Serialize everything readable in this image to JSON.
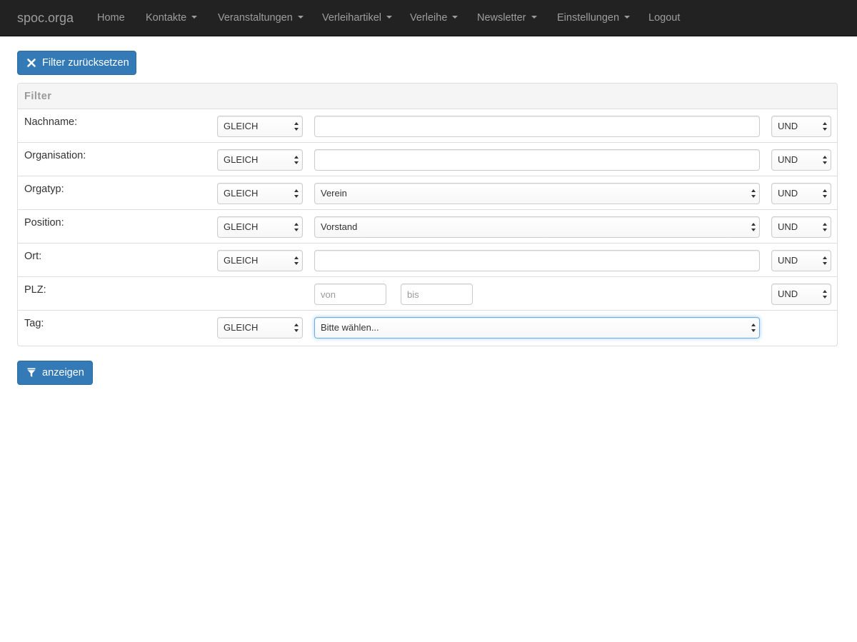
{
  "navbar": {
    "brand": "spoc.orga",
    "items": [
      {
        "label": "Home",
        "dropdown": false
      },
      {
        "label": "Kontakte",
        "dropdown": true
      },
      {
        "label": "Veranstaltungen",
        "dropdown": true
      },
      {
        "label": "Verleihartikel",
        "dropdown": true
      },
      {
        "label": "Verleihe",
        "dropdown": true
      },
      {
        "label": "Newsletter",
        "dropdown": true
      },
      {
        "label": "Einstellungen",
        "dropdown": true
      },
      {
        "label": "Logout",
        "dropdown": false
      }
    ]
  },
  "reset_button": {
    "label": "Filter zurücksetzen",
    "icon": "close-icon"
  },
  "filter": {
    "title": "Filter",
    "rows": [
      {
        "label": "Nachname:",
        "operator": "GLEICH",
        "value": "",
        "value_type": "text",
        "conjunction": "UND"
      },
      {
        "label": "Organisation:",
        "operator": "GLEICH",
        "value": "",
        "value_type": "text",
        "conjunction": "UND"
      },
      {
        "label": "Orgatyp:",
        "operator": "GLEICH",
        "value": "Verein",
        "value_type": "select",
        "conjunction": "UND"
      },
      {
        "label": "Position:",
        "operator": "GLEICH",
        "value": "Vorstand",
        "value_type": "select",
        "conjunction": "UND"
      },
      {
        "label": "Ort:",
        "operator": "GLEICH",
        "value": "",
        "value_type": "text",
        "conjunction": "UND"
      },
      {
        "label": "PLZ:",
        "from_placeholder": "von",
        "to_placeholder": "bis",
        "value_type": "range",
        "conjunction": "UND"
      },
      {
        "label": "Tag:",
        "operator": "GLEICH",
        "value": "Bitte wählen...",
        "value_type": "select"
      }
    ]
  },
  "show_button": {
    "label": "anzeigen",
    "icon": "filter-icon"
  },
  "colors": {
    "navbar_bg": "#222222",
    "nav_text": "#9d9d9d",
    "primary": "#337ab7",
    "focus_border": "#66afe9"
  }
}
